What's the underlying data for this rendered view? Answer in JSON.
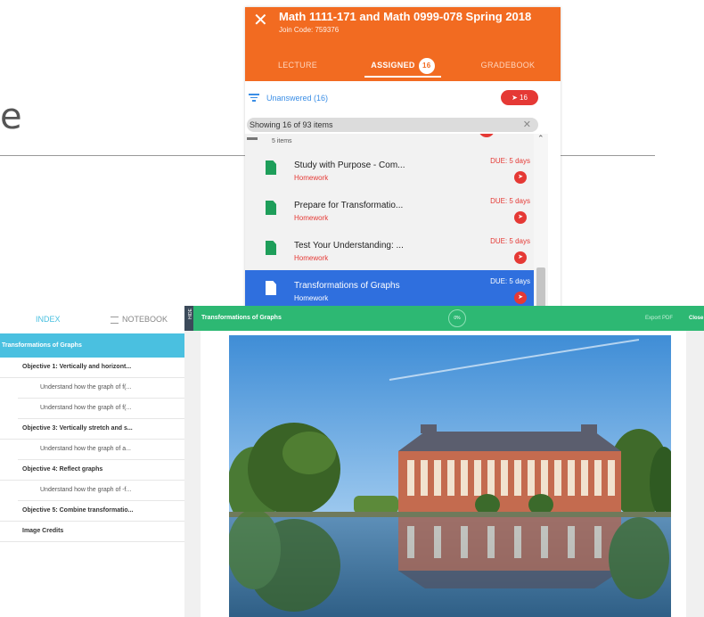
{
  "background": {
    "slide_letter": "e"
  },
  "app": {
    "title": "Math 1111-171 and Math 0999-078 Spring 2018",
    "join_code": "Join Code: 759376",
    "close_glyph": "✕",
    "tabs": [
      {
        "label": "LECTURE"
      },
      {
        "label": "ASSIGNED",
        "badge": "16"
      },
      {
        "label": "GRADEBOOK"
      }
    ],
    "filter": {
      "label": "Unanswered (16)",
      "send_count": "16"
    },
    "showing": "Showing 16 of 93 items",
    "group": {
      "label": "5 items"
    },
    "items": [
      {
        "title": "Study with Purpose - Com...",
        "type": "Homework",
        "due": "DUE: 5 days"
      },
      {
        "title": "Prepare for Transformatio...",
        "type": "Homework",
        "due": "DUE: 5 days"
      },
      {
        "title": "Test Your Understanding: ...",
        "type": "Homework",
        "due": "DUE: 5 days"
      },
      {
        "title": "Transformations of Graphs",
        "type": "Homework",
        "due": "DUE: 5 days"
      }
    ],
    "colors": {
      "header": "#f26b21",
      "accent": "#3a8ee6",
      "due": "#e53935",
      "selected": "#2f6fde"
    }
  },
  "reader": {
    "tabs": {
      "index": "INDEX",
      "notebook": "NOTEBOOK"
    },
    "toc_title": "Transformations of Graphs",
    "toc": [
      {
        "label": "Objective 1: Vertically and horizont...",
        "level": 1
      },
      {
        "label": "Understand how the graph of f(...",
        "level": 2
      },
      {
        "label": "Understand how the graph of f(...",
        "level": 2
      },
      {
        "label": "Objective 3: Vertically stretch and s...",
        "level": 1
      },
      {
        "label": "Understand how the graph of a...",
        "level": 2
      },
      {
        "label": "Objective 4: Reflect graphs",
        "level": 1
      },
      {
        "label": "Understand how the graph of -f...",
        "level": 2
      },
      {
        "label": "Objective 5: Combine transformatio...",
        "level": 1
      },
      {
        "label": "Image Credits",
        "level": 1
      }
    ],
    "content_bar": {
      "side_tab": "HIDE",
      "title": "Transformations of Graphs",
      "progress": "0%",
      "export": "Export PDF",
      "close": "Close"
    },
    "colors": {
      "index": "#4ac0e0",
      "content_bar": "#2db873"
    }
  }
}
